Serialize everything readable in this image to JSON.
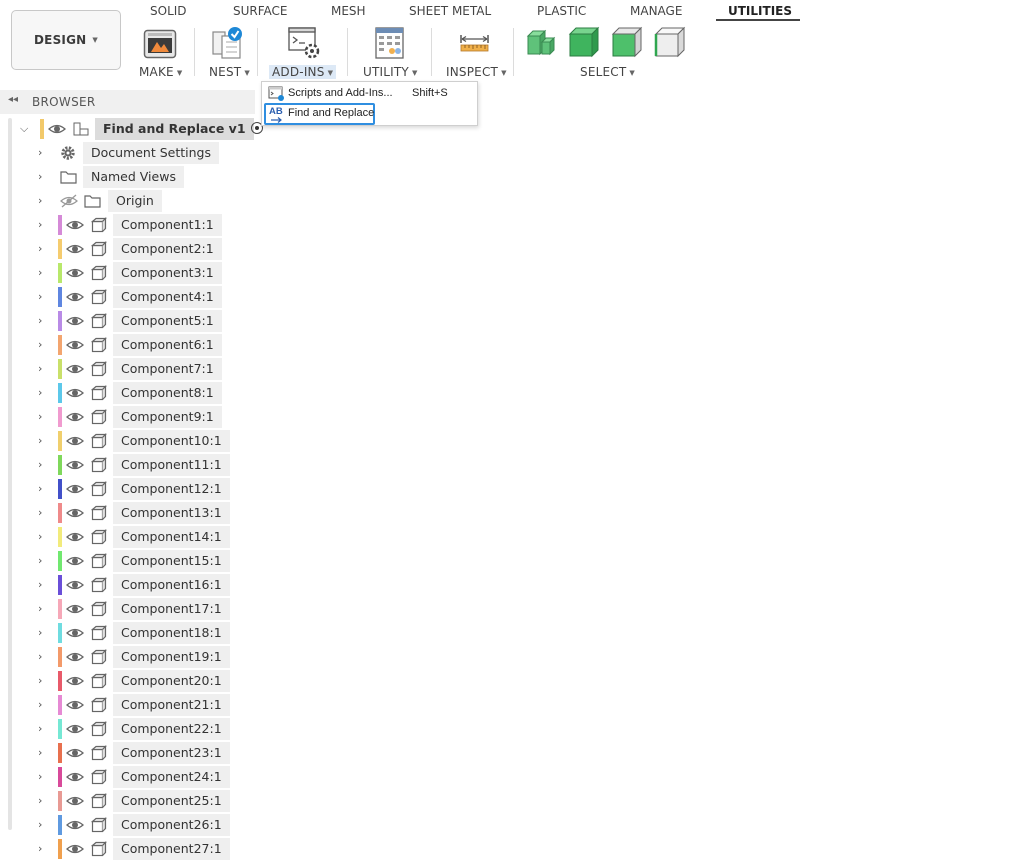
{
  "toolbar": {
    "workspace_label": "DESIGN",
    "tabs": [
      "SOLID",
      "SURFACE",
      "MESH",
      "SHEET METAL",
      "PLASTIC",
      "MANAGE",
      "UTILITIES"
    ],
    "active_tab": "UTILITIES",
    "groups": [
      "MAKE",
      "NEST",
      "ADD-INS",
      "UTILITY",
      "INSPECT",
      "SELECT"
    ]
  },
  "browser": {
    "title": "BROWSER",
    "root": "Find and Replace v1",
    "items": [
      "Document Settings",
      "Named Views",
      "Origin"
    ],
    "components": [
      {
        "name": "Component1:1",
        "color": "#d58ad7"
      },
      {
        "name": "Component2:1",
        "color": "#f5cc6f"
      },
      {
        "name": "Component3:1",
        "color": "#b8e86b"
      },
      {
        "name": "Component4:1",
        "color": "#5f86e0"
      },
      {
        "name": "Component5:1",
        "color": "#b98be6"
      },
      {
        "name": "Component6:1",
        "color": "#f3a56f"
      },
      {
        "name": "Component7:1",
        "color": "#c9e06a"
      },
      {
        "name": "Component8:1",
        "color": "#5cc8ea"
      },
      {
        "name": "Component9:1",
        "color": "#f09bcf"
      },
      {
        "name": "Component10:1",
        "color": "#f0cf6d"
      },
      {
        "name": "Component11:1",
        "color": "#7fd85b"
      },
      {
        "name": "Component12:1",
        "color": "#4250c9"
      },
      {
        "name": "Component13:1",
        "color": "#ef8a8a"
      },
      {
        "name": "Component14:1",
        "color": "#f2eb7c"
      },
      {
        "name": "Component15:1",
        "color": "#71e870"
      },
      {
        "name": "Component16:1",
        "color": "#6a4fd8"
      },
      {
        "name": "Component17:1",
        "color": "#f6a8b8"
      },
      {
        "name": "Component18:1",
        "color": "#6fdce0"
      },
      {
        "name": "Component19:1",
        "color": "#f39a6a"
      },
      {
        "name": "Component20:1",
        "color": "#e85a6a"
      },
      {
        "name": "Component21:1",
        "color": "#e68ad4"
      },
      {
        "name": "Component22:1",
        "color": "#76e8d4"
      },
      {
        "name": "Component23:1",
        "color": "#e8704e"
      },
      {
        "name": "Component24:1",
        "color": "#d84a9a"
      },
      {
        "name": "Component25:1",
        "color": "#e89a94"
      },
      {
        "name": "Component26:1",
        "color": "#5f9ae0"
      },
      {
        "name": "Component27:1",
        "color": "#f0a04e"
      }
    ]
  },
  "menu": {
    "scripts_label": "Scripts and Add-Ins...",
    "scripts_shortcut": "Shift+S",
    "find_label": "Find and Replace"
  }
}
